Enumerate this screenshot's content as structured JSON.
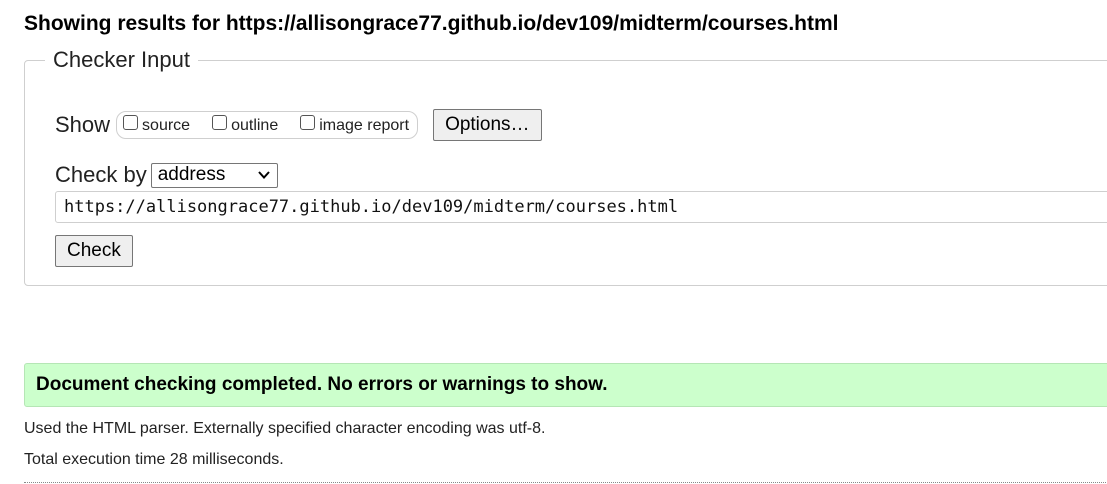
{
  "header": {
    "title": "Showing results for https://allisongrace77.github.io/dev109/midterm/courses.html"
  },
  "checker": {
    "legend": "Checker Input",
    "show_label": "Show",
    "show_options": [
      {
        "label": "source",
        "checked": false
      },
      {
        "label": "outline",
        "checked": false
      },
      {
        "label": "image report",
        "checked": false
      }
    ],
    "options_button_label": "Options…",
    "check_by_label": "Check by",
    "check_by_selected": "address",
    "url_value": "https://allisongrace77.github.io/dev109/midterm/courses.html",
    "check_button_label": "Check"
  },
  "results": {
    "success_message": "Document checking completed. No errors or warnings to show.",
    "success_color": "#ccffcc",
    "parser_info": "Used the HTML parser. Externally specified character encoding was utf-8.",
    "execution_time": "Total execution time 28 milliseconds."
  }
}
